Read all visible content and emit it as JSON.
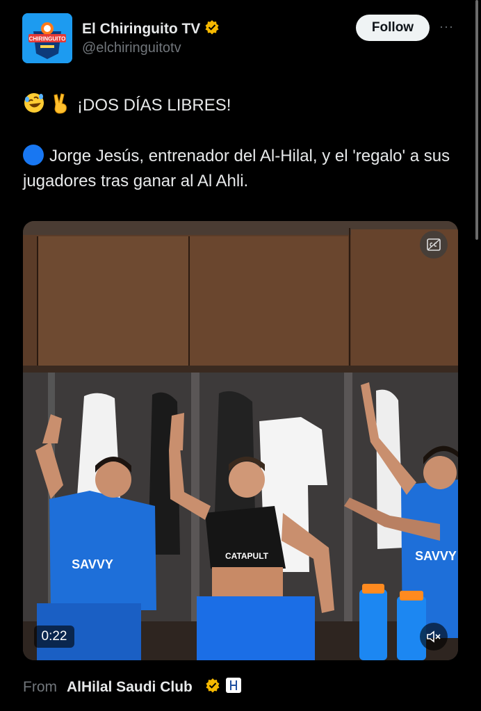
{
  "account": {
    "avatar_text": "CHIRINGUITO",
    "name": "El Chiringuito TV",
    "handle": "@elchiringuitotv",
    "follow_label": "Follow",
    "more_label": "···"
  },
  "tweet": {
    "emoji_laugh": "🤣",
    "emoji_victory": "✌",
    "headline": "¡DOS DÍAS LIBRES!",
    "body": "Jorge Jesús, entrenador del Al-Hilal, y el 'regalo' a sus jugadores tras ganar al Al Ahli."
  },
  "video": {
    "duration": "0:22",
    "shirt_sponsor": "SAVVY",
    "shirt_sponsor_2": "SAVVY",
    "vest_brand": "CATAPULT"
  },
  "source": {
    "from_label": "From",
    "name": "AlHilal Saudi Club"
  },
  "colors": {
    "verified": "#f5b800",
    "follow_bg": "#eff3f4",
    "hilal_blue": "#1e6fd9",
    "dot_blue": "#1877f2"
  }
}
